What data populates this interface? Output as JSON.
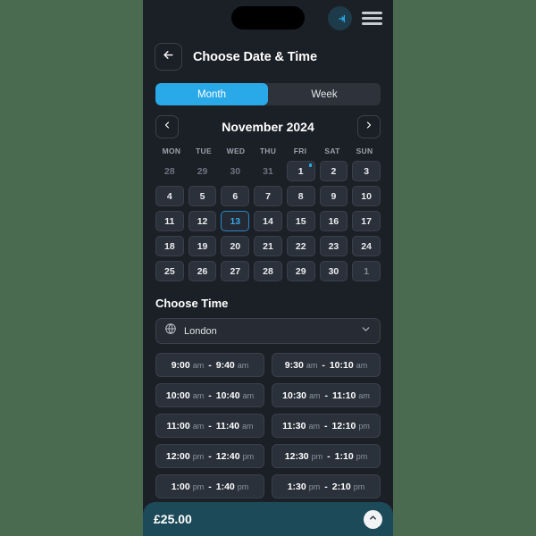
{
  "topbar": {
    "login_icon": "login-icon",
    "menu_icon": "hamburger-menu-icon",
    "notch": "dynamic-island"
  },
  "header": {
    "back_icon": "arrow-left-icon",
    "title": "Choose Date & Time"
  },
  "tabs": [
    {
      "label": "Month",
      "active": true
    },
    {
      "label": "Week",
      "active": false
    }
  ],
  "calendar": {
    "prev_icon": "chevron-left-icon",
    "next_icon": "chevron-right-icon",
    "month_label": "November 2024",
    "weekdays": [
      "MON",
      "TUE",
      "WED",
      "THU",
      "FRI",
      "SAT",
      "SUN"
    ],
    "days": [
      {
        "n": "28",
        "state": "muted"
      },
      {
        "n": "29",
        "state": "muted"
      },
      {
        "n": "30",
        "state": "muted"
      },
      {
        "n": "31",
        "state": "muted"
      },
      {
        "n": "1",
        "state": "normal",
        "dot": true
      },
      {
        "n": "2",
        "state": "normal"
      },
      {
        "n": "3",
        "state": "normal"
      },
      {
        "n": "4",
        "state": "normal"
      },
      {
        "n": "5",
        "state": "normal"
      },
      {
        "n": "6",
        "state": "normal"
      },
      {
        "n": "7",
        "state": "normal"
      },
      {
        "n": "8",
        "state": "normal"
      },
      {
        "n": "9",
        "state": "normal"
      },
      {
        "n": "10",
        "state": "normal"
      },
      {
        "n": "11",
        "state": "normal"
      },
      {
        "n": "12",
        "state": "normal"
      },
      {
        "n": "13",
        "state": "selected"
      },
      {
        "n": "14",
        "state": "normal"
      },
      {
        "n": "15",
        "state": "normal"
      },
      {
        "n": "16",
        "state": "normal"
      },
      {
        "n": "17",
        "state": "normal"
      },
      {
        "n": "18",
        "state": "normal"
      },
      {
        "n": "19",
        "state": "normal"
      },
      {
        "n": "20",
        "state": "normal"
      },
      {
        "n": "21",
        "state": "normal"
      },
      {
        "n": "22",
        "state": "normal"
      },
      {
        "n": "23",
        "state": "normal"
      },
      {
        "n": "24",
        "state": "normal"
      },
      {
        "n": "25",
        "state": "normal"
      },
      {
        "n": "26",
        "state": "normal"
      },
      {
        "n": "27",
        "state": "normal"
      },
      {
        "n": "28",
        "state": "normal"
      },
      {
        "n": "29",
        "state": "normal"
      },
      {
        "n": "30",
        "state": "normal"
      },
      {
        "n": "1",
        "state": "next-month"
      }
    ]
  },
  "choose_time": {
    "title": "Choose Time",
    "timezone": {
      "globe_icon": "globe-icon",
      "value": "London",
      "chevron_icon": "chevron-down-icon"
    },
    "separator": "-",
    "slots": [
      {
        "start": "9:00",
        "start_mer": "am",
        "end": "9:40",
        "end_mer": "am"
      },
      {
        "start": "9:30",
        "start_mer": "am",
        "end": "10:10",
        "end_mer": "am"
      },
      {
        "start": "10:00",
        "start_mer": "am",
        "end": "10:40",
        "end_mer": "am"
      },
      {
        "start": "10:30",
        "start_mer": "am",
        "end": "11:10",
        "end_mer": "am"
      },
      {
        "start": "11:00",
        "start_mer": "am",
        "end": "11:40",
        "end_mer": "am"
      },
      {
        "start": "11:30",
        "start_mer": "am",
        "end": "12:10",
        "end_mer": "pm"
      },
      {
        "start": "12:00",
        "start_mer": "pm",
        "end": "12:40",
        "end_mer": "pm"
      },
      {
        "start": "12:30",
        "start_mer": "pm",
        "end": "1:10",
        "end_mer": "pm"
      },
      {
        "start": "1:00",
        "start_mer": "pm",
        "end": "1:40",
        "end_mer": "pm"
      },
      {
        "start": "1:30",
        "start_mer": "pm",
        "end": "2:10",
        "end_mer": "pm"
      }
    ]
  },
  "bottom_bar": {
    "price": "£25.00",
    "expand_icon": "chevron-up-icon"
  },
  "colors": {
    "page_background": "#4a6b50",
    "phone_background": "#1b1f26",
    "accent_blue": "#29a9e8",
    "bottom_bar": "#1d4a58",
    "card": "#2b313a",
    "border": "#3b414b"
  }
}
